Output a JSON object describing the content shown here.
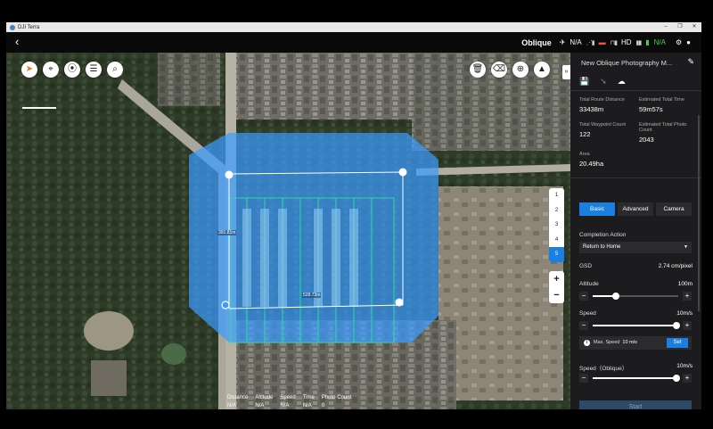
{
  "window": {
    "title": "DJI Terra",
    "controls": [
      "–",
      "❐",
      "✕"
    ]
  },
  "topbar": {
    "back_icon": "back-arrow-icon",
    "mode": "Oblique",
    "aircraft_status": "N/A",
    "hd_label": "HD",
    "rc_status": "N/A"
  },
  "map": {
    "dimension_left": "391.81m",
    "dimension_bottom": "528.73m",
    "waypoint_buttons": [
      "1",
      "2",
      "3",
      "4",
      "5"
    ],
    "active_waypoint": "5",
    "zoom_in": "+",
    "zoom_out": "−",
    "collapse_label": "»",
    "bottom_stats": [
      {
        "label": "Distance",
        "value": "N/A"
      },
      {
        "label": "Altitude",
        "value": "N/A"
      },
      {
        "label": "Speed",
        "value": "N/A"
      },
      {
        "label": "Time",
        "value": "N/A"
      },
      {
        "label": "Photo Count",
        "value": "0"
      }
    ]
  },
  "panel": {
    "title": "New Oblique Photography M...",
    "stats": {
      "route_distance_label": "Total Route Distance",
      "route_distance": "33438m",
      "total_time_label": "Estimated Total Time",
      "total_time": "59m57s",
      "waypoint_count_label": "Total Waypoint Count",
      "waypoint_count": "122",
      "photo_count_label": "Estimated Total Photo Count",
      "photo_count": "2043",
      "area_label": "Area",
      "area": "20.49ha"
    },
    "tabs": [
      "Basic",
      "Advanced",
      "Camera"
    ],
    "active_tab": "Basic",
    "completion_action_label": "Completion Action",
    "completion_action_value": "Return to Home",
    "gsd_label": "GSD",
    "gsd_value": "2.74 cm/pixel",
    "altitude_label": "Altitude",
    "altitude_value": "100m",
    "altitude_level": 0.27,
    "speed_label": "Speed",
    "speed_value": "10m/s",
    "speed_level": 0.98,
    "max_speed_text": "Max. Speed",
    "max_speed_value": "10 m/s",
    "set_label": "Set",
    "oblique_speed_label": "Speed（Oblique）",
    "oblique_speed_value": "10m/s",
    "oblique_speed_level": 0.98,
    "start_label": "Start"
  },
  "colors": {
    "accent": "#1a7fe0",
    "area_fill": "#3b9cff",
    "route": "#2fe0a0"
  }
}
